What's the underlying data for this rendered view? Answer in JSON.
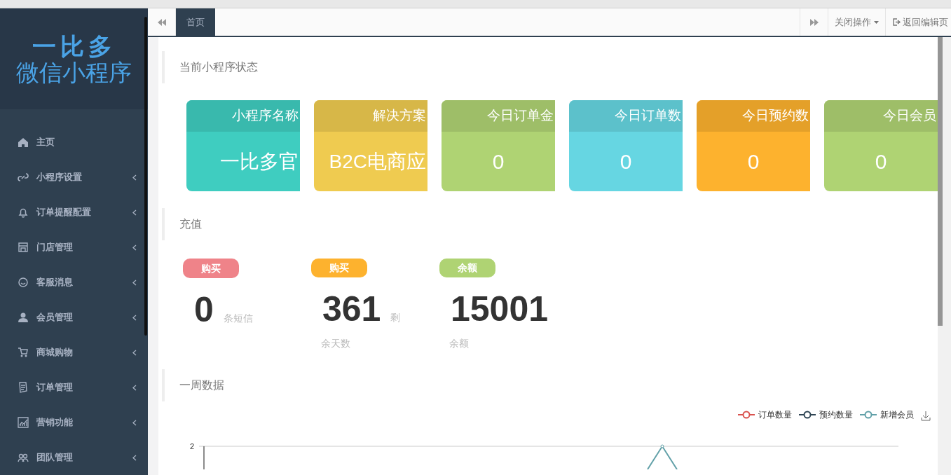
{
  "logo": {
    "line_1": "一比多",
    "line_2": "微信小程序"
  },
  "sidebar": {
    "items": [
      {
        "label": "主页",
        "has_submenu": false
      },
      {
        "label": "小程序设置",
        "has_submenu": true
      },
      {
        "label": "订单提醒配置",
        "has_submenu": true
      },
      {
        "label": "门店管理",
        "has_submenu": true
      },
      {
        "label": "客服消息",
        "has_submenu": true
      },
      {
        "label": "会员管理",
        "has_submenu": true
      },
      {
        "label": "商城购物",
        "has_submenu": true
      },
      {
        "label": "订单管理",
        "has_submenu": true
      },
      {
        "label": "营销功能",
        "has_submenu": true
      },
      {
        "label": "团队管理",
        "has_submenu": true
      }
    ]
  },
  "tabbar": {
    "tabs": [
      {
        "label": "首页",
        "selected": true
      }
    ],
    "close_menu": "关闭操作",
    "back_link": "返回编辑页"
  },
  "status_section": {
    "title": "当前小程序状态",
    "cards": [
      {
        "title": "小程序名称",
        "value": "一比多官",
        "color": "#3fcdc0",
        "kind": "text"
      },
      {
        "title": "解决方案",
        "value": "B2C电商应",
        "color": "#efcb50",
        "kind": "text"
      },
      {
        "title": "今日订单金",
        "value": "0",
        "color": "#afd373",
        "kind": "number"
      },
      {
        "title": "今日订单数",
        "value": "0",
        "color": "#66d6e2",
        "kind": "number"
      },
      {
        "title": "今日预约数",
        "value": "0",
        "color": "#fdb22e",
        "kind": "number"
      },
      {
        "title": "今日会员",
        "value": "0",
        "color": "#afd373",
        "kind": "number"
      }
    ]
  },
  "recharge_section": {
    "title": "充值",
    "items": [
      {
        "badge": "购买",
        "color": "#ef8389",
        "value": "0",
        "unit": "条短信"
      },
      {
        "badge": "购买",
        "color": "#fdb22e",
        "value": "361",
        "unit": "剩",
        "note": "余天数"
      },
      {
        "badge": "余额",
        "color": "#afd373",
        "value": "15001",
        "note": "余额"
      }
    ]
  },
  "week_section": {
    "title": "一周数据",
    "legend": [
      {
        "label": "订单数量",
        "color": "#d9534f"
      },
      {
        "label": "预约数量",
        "color": "#2f4554"
      },
      {
        "label": "新增会员",
        "color": "#61a0a8"
      }
    ],
    "y_tick": "2"
  }
}
